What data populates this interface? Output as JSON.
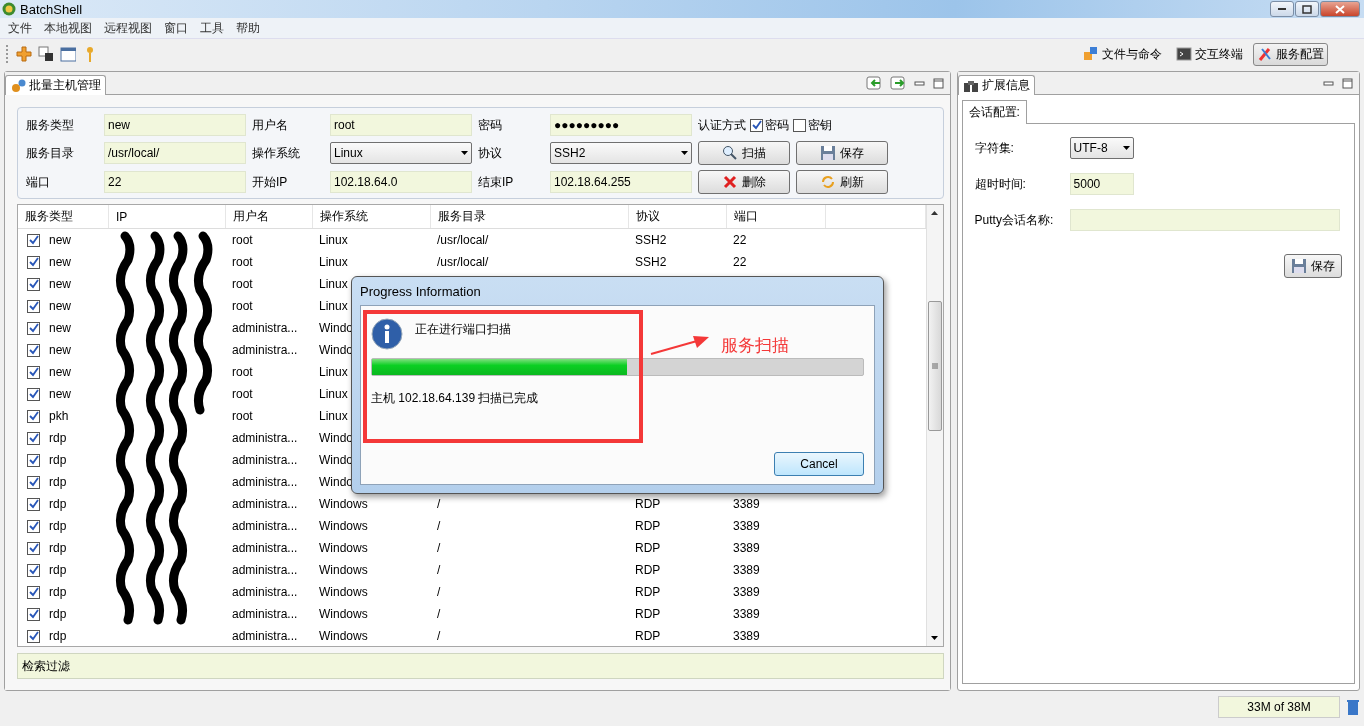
{
  "window": {
    "title": "BatchShell"
  },
  "menu": [
    "文件",
    "本地视图",
    "远程视图",
    "窗口",
    "工具",
    "帮助"
  ],
  "perspectives": [
    {
      "label": "文件与命令",
      "selected": false
    },
    {
      "label": "交互终端",
      "selected": false
    },
    {
      "label": "服务配置",
      "selected": true
    }
  ],
  "host_panel": {
    "tab": "批量主机管理",
    "form": [
      {
        "kind": "label",
        "text": "服务类型"
      },
      {
        "kind": "field",
        "value": "new"
      },
      {
        "kind": "label",
        "text": "用户名"
      },
      {
        "kind": "field",
        "value": "root"
      },
      {
        "kind": "label",
        "text": "密码"
      },
      {
        "kind": "field",
        "value": "●●●●●●●●●"
      },
      {
        "kind": "auth",
        "text": "认证方式",
        "options": [
          {
            "label": "密码",
            "checked": true
          },
          {
            "label": "密钥",
            "checked": false
          }
        ]
      },
      {
        "kind": "label",
        "text": "服务目录"
      },
      {
        "kind": "field",
        "value": "/usr/local/"
      },
      {
        "kind": "label",
        "text": "操作系统"
      },
      {
        "kind": "select",
        "value": "Linux"
      },
      {
        "kind": "label",
        "text": "协议"
      },
      {
        "kind": "select",
        "value": "SSH2"
      },
      {
        "kind": "button",
        "text": "扫描"
      },
      {
        "kind": "button",
        "text": "保存"
      },
      {
        "kind": "label",
        "text": "端口"
      },
      {
        "kind": "field",
        "value": "22"
      },
      {
        "kind": "label",
        "text": "开始IP"
      },
      {
        "kind": "field",
        "value": "102.18.64.0"
      },
      {
        "kind": "label",
        "text": "结束IP"
      },
      {
        "kind": "field",
        "value": "102.18.64.255"
      },
      {
        "kind": "button",
        "text": "删除"
      },
      {
        "kind": "button",
        "text": "刷新"
      }
    ],
    "table": {
      "columns": [
        "服务类型",
        "IP",
        "用户名",
        "操作系统",
        "服务目录",
        "协议",
        "端口"
      ],
      "rows": [
        {
          "checked": true,
          "service_type": "new",
          "user": "root",
          "os": "Linux",
          "dir": "/usr/local/",
          "protocol": "SSH2",
          "port": "22"
        },
        {
          "checked": true,
          "service_type": "new",
          "user": "root",
          "os": "Linux",
          "dir": "/usr/local/",
          "protocol": "SSH2",
          "port": "22"
        },
        {
          "checked": true,
          "service_type": "new",
          "user": "root",
          "os": "Linux"
        },
        {
          "checked": true,
          "service_type": "new",
          "user": "root",
          "os": "Linux"
        },
        {
          "checked": true,
          "service_type": "new",
          "user": "administra...",
          "os": "Windo"
        },
        {
          "checked": true,
          "service_type": "new",
          "user": "administra...",
          "os": "Windo"
        },
        {
          "checked": true,
          "service_type": "new",
          "user": "root",
          "os": "Linux"
        },
        {
          "checked": true,
          "service_type": "new",
          "user": "root",
          "os": "Linux"
        },
        {
          "checked": true,
          "service_type": "pkh",
          "user": "root",
          "os": "Linux"
        },
        {
          "checked": true,
          "service_type": "rdp",
          "user": "administra...",
          "os": "Windo"
        },
        {
          "checked": true,
          "service_type": "rdp",
          "user": "administra...",
          "os": "Windo"
        },
        {
          "checked": true,
          "service_type": "rdp",
          "user": "administra...",
          "os": "Windo"
        },
        {
          "checked": true,
          "service_type": "rdp",
          "user": "administra...",
          "os": "Windows",
          "dir": "/",
          "protocol": "RDP",
          "port": "3389"
        },
        {
          "checked": true,
          "service_type": "rdp",
          "user": "administra...",
          "os": "Windows",
          "dir": "/",
          "protocol": "RDP",
          "port": "3389"
        },
        {
          "checked": true,
          "service_type": "rdp",
          "user": "administra...",
          "os": "Windows",
          "dir": "/",
          "protocol": "RDP",
          "port": "3389"
        },
        {
          "checked": true,
          "service_type": "rdp",
          "user": "administra...",
          "os": "Windows",
          "dir": "/",
          "protocol": "RDP",
          "port": "3389"
        },
        {
          "checked": true,
          "service_type": "rdp",
          "user": "administra...",
          "os": "Windows",
          "dir": "/",
          "protocol": "RDP",
          "port": "3389"
        },
        {
          "checked": true,
          "service_type": "rdp",
          "user": "administra...",
          "os": "Windows",
          "dir": "/",
          "protocol": "RDP",
          "port": "3389"
        },
        {
          "checked": true,
          "service_type": "rdp",
          "user": "administra...",
          "os": "Windows",
          "dir": "/",
          "protocol": "RDP",
          "port": "3389"
        }
      ]
    },
    "filter": {
      "label": "检索过滤"
    }
  },
  "ext_panel": {
    "tab": "扩展信息",
    "subtab": "会话配置:",
    "charset": {
      "label": "字符集:",
      "value": "UTF-8"
    },
    "timeout": {
      "label": "超时时间:",
      "value": "5000"
    },
    "putty": {
      "label": "Putty会话名称:"
    },
    "save": "保存"
  },
  "dialog": {
    "title": "Progress Information",
    "message": "正在进行端口扫描",
    "level": 0.52,
    "detail": "主机 102.18.64.139 扫描已完成",
    "cancel": "Cancel"
  },
  "annotation": {
    "label": "服务扫描"
  },
  "status_bar": {
    "memory": "33M of 38M"
  }
}
